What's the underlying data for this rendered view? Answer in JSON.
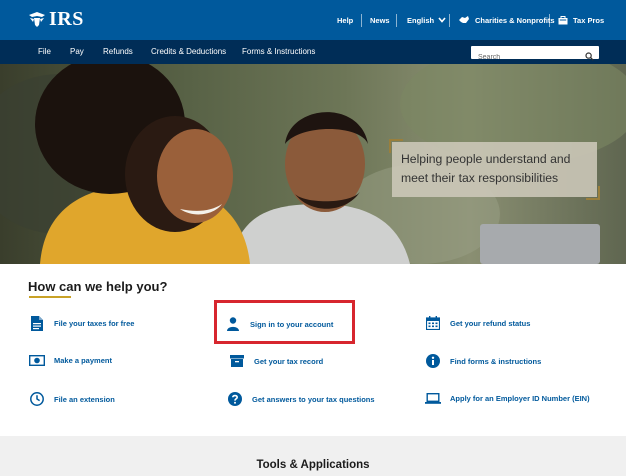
{
  "header": {
    "logo_text": "IRS",
    "utility_links": [
      {
        "label": "Help"
      },
      {
        "label": "News"
      },
      {
        "label": "English"
      },
      {
        "label": "Charities & Nonprofits",
        "icon": "handshake-icon"
      },
      {
        "label": "Tax Pros",
        "icon": "briefcase-icon"
      }
    ]
  },
  "nav": {
    "items": [
      {
        "label": "File"
      },
      {
        "label": "Pay"
      },
      {
        "label": "Refunds"
      },
      {
        "label": "Credits & Deductions"
      },
      {
        "label": "Forms & Instructions"
      }
    ],
    "search_placeholder": "Search"
  },
  "hero": {
    "caption": "Helping people understand and meet their tax responsibilities"
  },
  "help": {
    "title": "How can we help you?",
    "items": [
      {
        "label": "File your taxes for free",
        "icon": "document-icon"
      },
      {
        "label": "Sign in to your account",
        "icon": "user-icon"
      },
      {
        "label": "Get your refund status",
        "icon": "calendar-icon"
      },
      {
        "label": "Make a payment",
        "icon": "money-icon"
      },
      {
        "label": "Get your tax record",
        "icon": "archive-box-icon"
      },
      {
        "label": "Find forms & instructions",
        "icon": "info-icon"
      },
      {
        "label": "File an extension",
        "icon": "clock-icon"
      },
      {
        "label": "Get answers to your tax questions",
        "icon": "question-icon"
      },
      {
        "label": "Apply for an Employer ID Number (EIN)",
        "icon": "laptop-icon"
      }
    ]
  },
  "tools": {
    "title": "Tools & Applications"
  },
  "colors": {
    "header_blue": "#00599c",
    "nav_navy": "#002d57",
    "link_blue": "#00599c",
    "accent_gold": "#c9a227",
    "highlight_red": "#d7262e"
  }
}
